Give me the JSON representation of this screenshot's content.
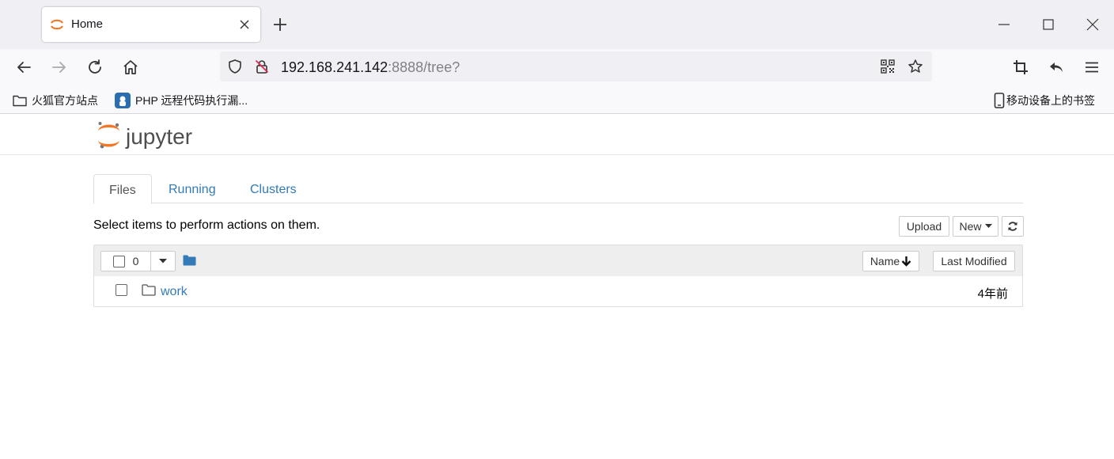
{
  "browser": {
    "tab": {
      "title": "Home"
    },
    "url": {
      "host": "192.168.241.142",
      "rest": ":8888/tree?"
    },
    "bookmarks": [
      {
        "label": "火狐官方站点"
      },
      {
        "label": "PHP 远程代码执行漏..."
      }
    ],
    "mobile_bookmarks": "移动设备上的书签"
  },
  "jupyter": {
    "logo_text": "jupyter",
    "tabs": [
      {
        "label": "Files"
      },
      {
        "label": "Running"
      },
      {
        "label": "Clusters"
      }
    ],
    "toolbar": {
      "hint": "Select items to perform actions on them.",
      "upload_label": "Upload",
      "new_label": "New"
    },
    "list_header": {
      "selected_count": "0",
      "name_label": "Name",
      "modified_label": "Last Modified"
    },
    "items": [
      {
        "name": "work",
        "modified": "4年前",
        "type": "folder"
      }
    ]
  },
  "colors": {
    "link": "#337ab7",
    "jupyter_orange": "#f37726",
    "chrome_bg": "#f0f0f4"
  }
}
